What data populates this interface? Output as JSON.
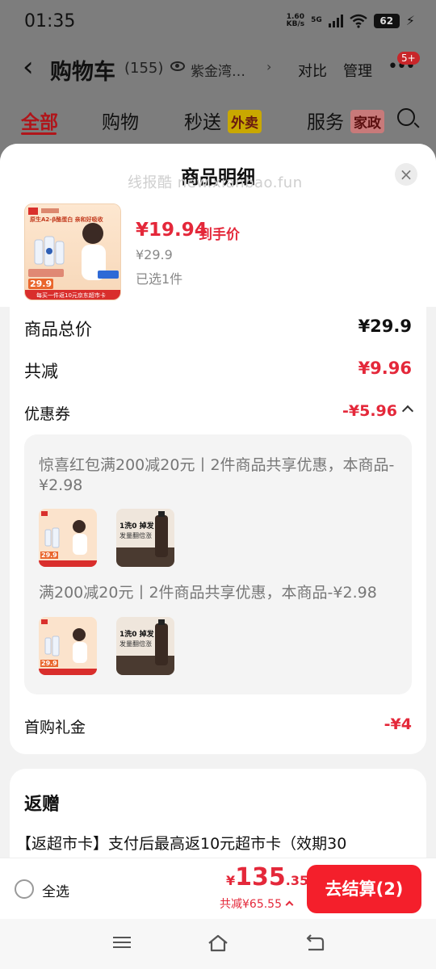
{
  "status_bar": {
    "time": "01:35",
    "net_speed_value": "1.60",
    "net_speed_unit": "KB/s",
    "network": "5G",
    "battery": "62"
  },
  "nav": {
    "title": "购物车",
    "count": "(155)",
    "address": "紫金湾…",
    "compare": "对比",
    "manage": "管理",
    "badge": "5+"
  },
  "tabs": [
    {
      "label": "全部"
    },
    {
      "label": "购物"
    },
    {
      "label": "秒送"
    },
    {
      "label": "服务"
    }
  ],
  "tab_tags": {
    "miaosong": "外卖",
    "fuwu": "家政"
  },
  "sheet": {
    "title": "商品明细",
    "watermark": "线报酷 new.xianbao.fun",
    "close": "×"
  },
  "product": {
    "final_price": "¥19.94",
    "final_price_label": "到手价",
    "original_price": "¥29.9",
    "selected_qty": "已选1件",
    "image_banner": "原生A2-β酪蛋白 亲和好吸收",
    "image_price": "29.9",
    "image_footer": "每买一件返10元京东超市卡"
  },
  "summary": {
    "total_label": "商品总价",
    "total_value": "¥29.9",
    "reduce_label": "共减",
    "reduce_value": "¥9.96",
    "coupon_label": "优惠券",
    "coupon_value": "-¥5.96",
    "gift_label": "首购礼金",
    "gift_value": "-¥4"
  },
  "coupons": [
    {
      "text": "惊喜红包满200减20元丨2件商品共享优惠，本商品-¥2.98"
    },
    {
      "text": "满200减20元丨2件商品共享优惠，本商品-¥2.98"
    }
  ],
  "thumbs": {
    "shampoo_line1": "1洗0 掉发",
    "shampoo_line2": "发量翻倍涨",
    "milk_price": "29.9"
  },
  "rebate": {
    "title": "返赠",
    "text": "【返超市卡】支付后最高返10元超市卡（效期30"
  },
  "checkout": {
    "select_all": "全选",
    "total_yen": "¥",
    "total_int": "135",
    "total_dec": ".35",
    "discount": "共减¥65.55",
    "button": "去结算(2)"
  },
  "colors": {
    "accent_red": "#e4283a",
    "button_red": "#f41f2b",
    "tab_active": "#b0151a"
  }
}
